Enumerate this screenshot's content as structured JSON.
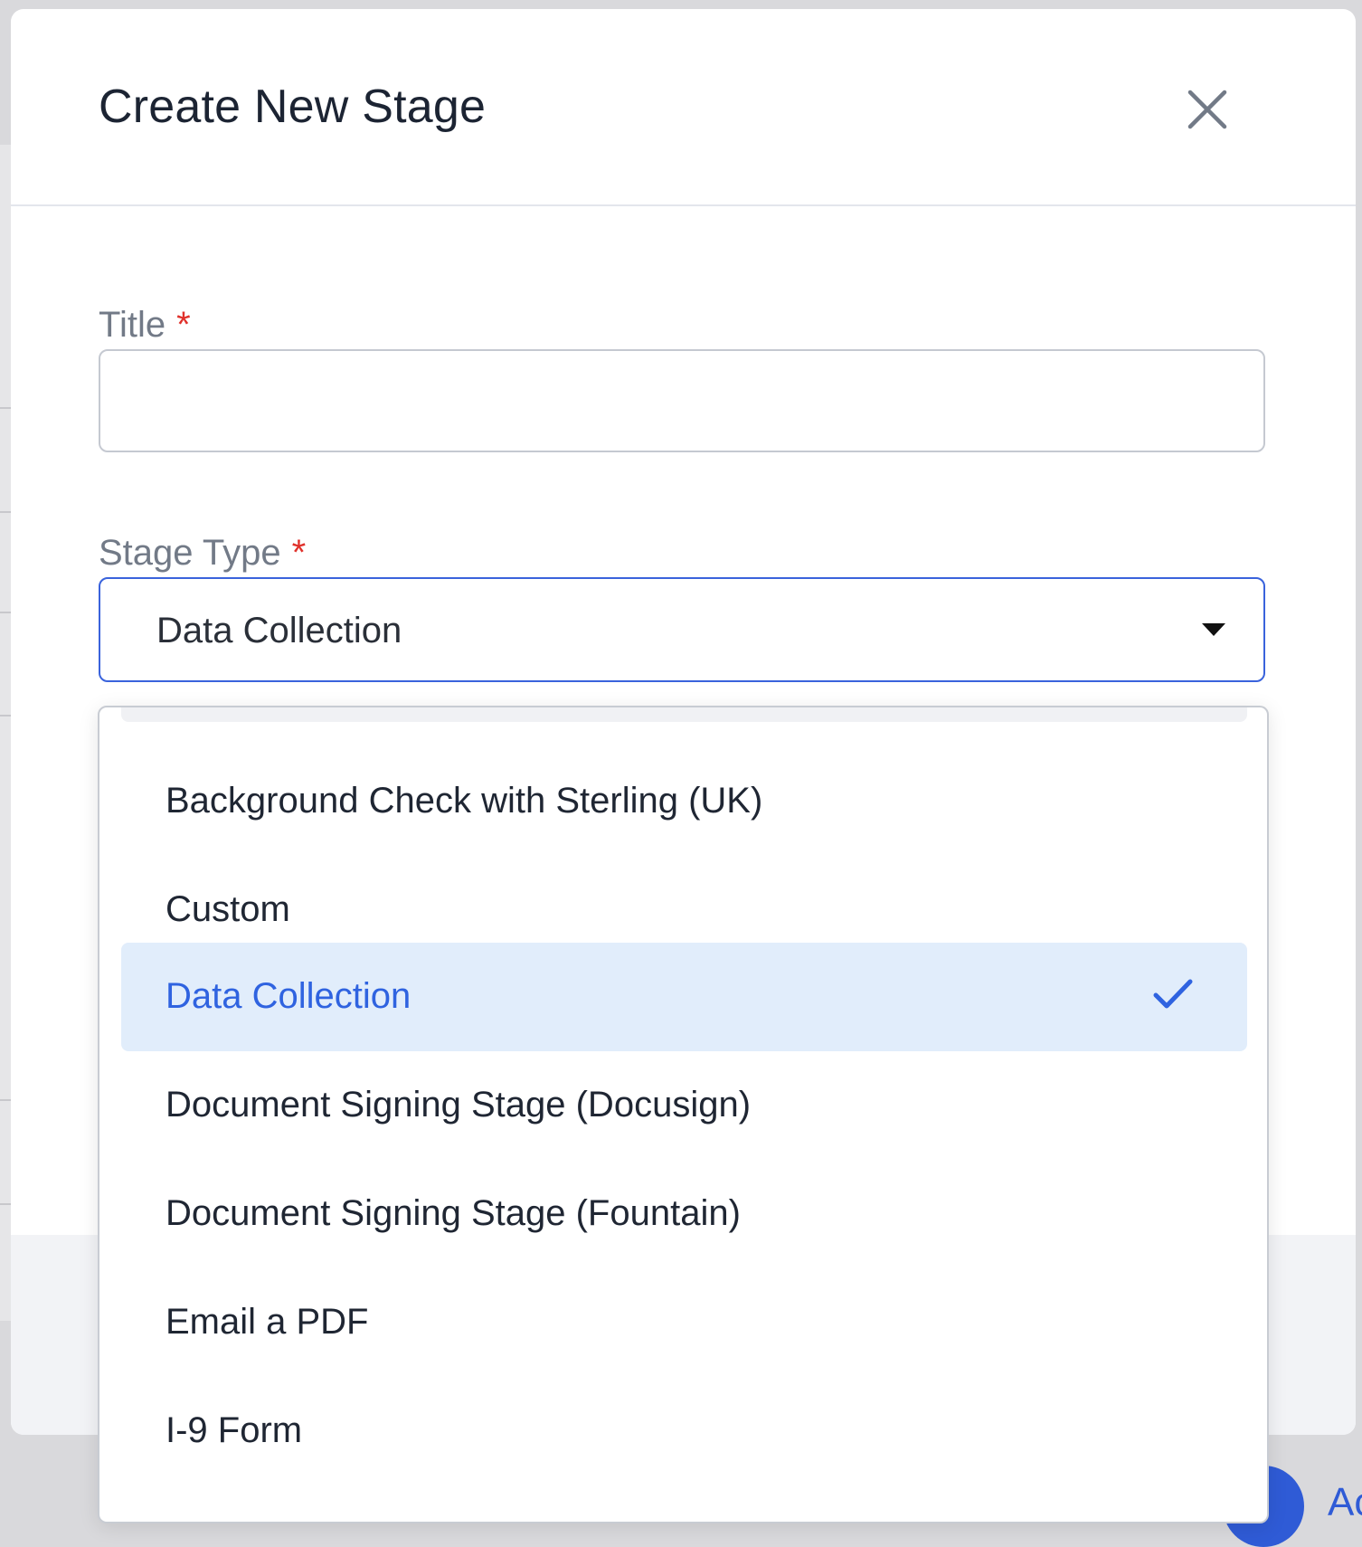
{
  "modal": {
    "title": "Create New Stage",
    "close_icon": "close-icon"
  },
  "form": {
    "title_field": {
      "label": "Title",
      "required_marker": "*",
      "value": "",
      "placeholder": ""
    },
    "stage_type_field": {
      "label": "Stage Type",
      "required_marker": "*",
      "selected_value": "Data Collection",
      "dropdown_icon": "caret-down-icon"
    }
  },
  "dropdown": {
    "options": [
      {
        "label": "Background Check with Sterling (UK)",
        "selected": false
      },
      {
        "label": "Custom",
        "selected": false
      },
      {
        "label": "Data Collection",
        "selected": true,
        "icon": "checkmark-icon"
      },
      {
        "label": "Document Signing Stage (Docusign)",
        "selected": false
      },
      {
        "label": "Document Signing Stage (Fountain)",
        "selected": false
      },
      {
        "label": "Email a PDF",
        "selected": false
      },
      {
        "label": "I-9 Form",
        "selected": false
      }
    ]
  },
  "background": {
    "fab_text_fragment": "Ac"
  },
  "colors": {
    "accent": "#3a63dc",
    "required": "#e0312b",
    "selected_bg": "#e1edfb",
    "selected_text": "#2f63e0",
    "text_primary": "#1f2633",
    "label": "#727a87"
  }
}
